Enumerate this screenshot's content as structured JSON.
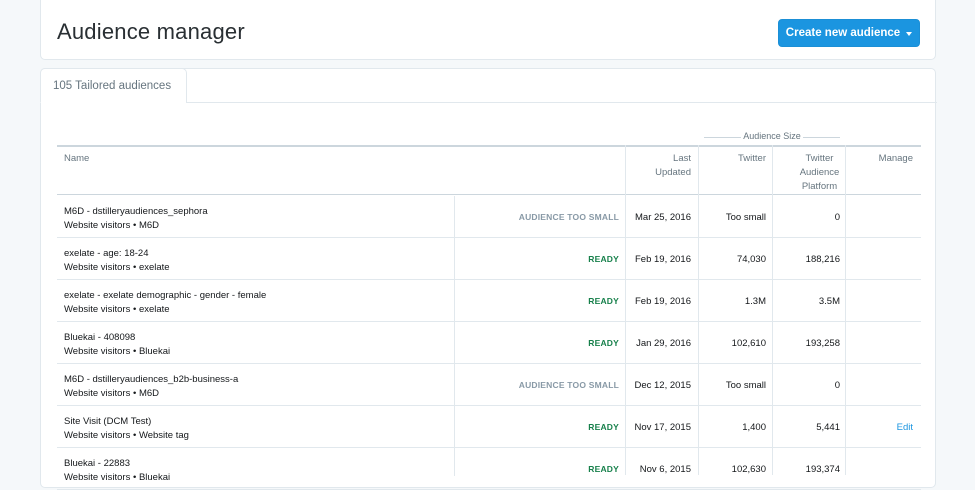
{
  "header": {
    "title": "Audience manager",
    "create_button_label": "Create new audience"
  },
  "tabs": [
    {
      "label": "105 Tailored audiences"
    }
  ],
  "table": {
    "group_header": "Audience Size",
    "columns": {
      "name": "Name",
      "last_updated": [
        "Last",
        "Updated"
      ],
      "twitter": "Twitter",
      "tap": [
        "Twitter",
        "Audience",
        "Platform"
      ],
      "manage": "Manage"
    },
    "rows": [
      {
        "name": "M6D - dstilleryaudiences_sephora",
        "subtitle": "Website visitors • M6D",
        "status": "AUDIENCE TOO SMALL",
        "status_type": "small",
        "last_updated": "Mar 25, 2016",
        "twitter": "Too small",
        "tap": "0",
        "manage": ""
      },
      {
        "name": "exelate - age: 18-24",
        "subtitle": "Website visitors • exelate",
        "status": "READY",
        "status_type": "ready",
        "last_updated": "Feb 19, 2016",
        "twitter": "74,030",
        "tap": "188,216",
        "manage": ""
      },
      {
        "name": "exelate - exelate demographic - gender - female",
        "subtitle": "Website visitors • exelate",
        "status": "READY",
        "status_type": "ready",
        "last_updated": "Feb 19, 2016",
        "twitter": "1.3M",
        "tap": "3.5M",
        "manage": ""
      },
      {
        "name": "Bluekai - 408098",
        "subtitle": "Website visitors • Bluekai",
        "status": "READY",
        "status_type": "ready",
        "last_updated": "Jan 29, 2016",
        "twitter": "102,610",
        "tap": "193,258",
        "manage": ""
      },
      {
        "name": "M6D - dstilleryaudiences_b2b-business-a",
        "subtitle": "Website visitors • M6D",
        "status": "AUDIENCE TOO SMALL",
        "status_type": "small",
        "last_updated": "Dec 12, 2015",
        "twitter": "Too small",
        "tap": "0",
        "manage": ""
      },
      {
        "name": "Site Visit (DCM Test)",
        "subtitle": "Website visitors • Website tag",
        "status": "READY",
        "status_type": "ready",
        "last_updated": "Nov 17, 2015",
        "twitter": "1,400",
        "tap": "5,441",
        "manage": "Edit"
      },
      {
        "name": "Bluekai - 22883",
        "subtitle": "Website visitors • Bluekai",
        "status": "READY",
        "status_type": "ready",
        "last_updated": "Nov 6, 2015",
        "twitter": "102,630",
        "tap": "193,374",
        "manage": ""
      }
    ]
  },
  "colors": {
    "accent": "#1b95e0",
    "ready": "#17804b",
    "muted": "#8899a6",
    "background": "#f5f8fa"
  }
}
